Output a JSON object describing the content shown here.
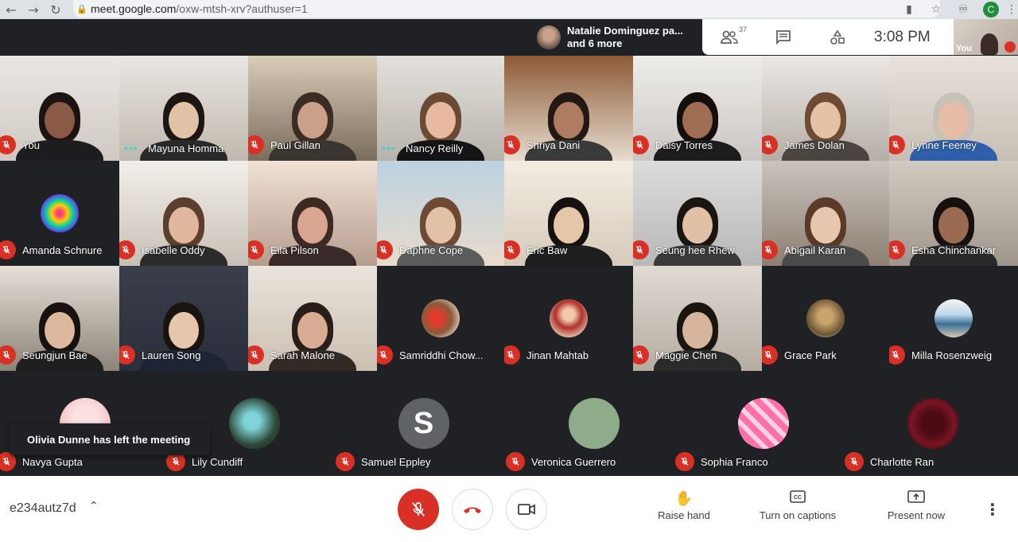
{
  "browser": {
    "url_host": "meet.google.com",
    "url_path": "/oxw-mtsh-xrv?authuser=1",
    "profile_initial": "C"
  },
  "notification": {
    "line1": "Natalie Dominguez pa...",
    "line2": "and 6 more"
  },
  "top_panel": {
    "participant_count": "37",
    "time": "3:08 PM",
    "self_label": "You"
  },
  "participants": [
    {
      "name": "You",
      "state": "muted"
    },
    {
      "name": "Mayuna Homma",
      "state": "talking"
    },
    {
      "name": "Paul Gillan",
      "state": "muted"
    },
    {
      "name": "Nancy Reilly",
      "state": "talking"
    },
    {
      "name": "Shriya Dani",
      "state": "muted"
    },
    {
      "name": "Daisy Torres",
      "state": "muted"
    },
    {
      "name": "James Dolan",
      "state": "muted"
    },
    {
      "name": "Lynne Feeney",
      "state": "muted"
    },
    {
      "name": "Amanda Schnure",
      "state": "muted"
    },
    {
      "name": "Isabelle Oddy",
      "state": "muted"
    },
    {
      "name": "Ella Pilson",
      "state": "muted"
    },
    {
      "name": "Daphne Cope",
      "state": "muted"
    },
    {
      "name": "Eric Baw",
      "state": "muted"
    },
    {
      "name": "Seung hee Rhew",
      "state": "muted"
    },
    {
      "name": "Abigail Karan",
      "state": "muted"
    },
    {
      "name": "Esha Chinchankar",
      "state": "muted"
    },
    {
      "name": "Seungjun Bae",
      "state": "muted"
    },
    {
      "name": "Lauren Song",
      "state": "muted"
    },
    {
      "name": "Sarah Malone",
      "state": "muted"
    },
    {
      "name": "Samriddhi Chow...",
      "state": "muted"
    },
    {
      "name": "Jinan Mahtab",
      "state": "muted"
    },
    {
      "name": "Maggie Chen",
      "state": "muted"
    },
    {
      "name": "Grace Park",
      "state": "muted"
    },
    {
      "name": "Milla Rosenzweig",
      "state": "muted"
    }
  ],
  "bottom_row": [
    {
      "name": "Navya Gupta"
    },
    {
      "name": "Lily Cundiff"
    },
    {
      "name": "Samuel Eppley",
      "initial": "S"
    },
    {
      "name": "Veronica Guerrero"
    },
    {
      "name": "Sophia Franco"
    },
    {
      "name": "Charlotte Ran"
    }
  ],
  "toast": "Olivia Dunne has left the meeting",
  "bottom_bar": {
    "meeting_code": "e234autz7d",
    "raise_hand": "Raise hand",
    "captions": "Turn on captions",
    "present": "Present now"
  },
  "colors": {
    "mic_off_red": "#d93025",
    "talking_teal": "#4fd1c5",
    "background": "#202124"
  }
}
